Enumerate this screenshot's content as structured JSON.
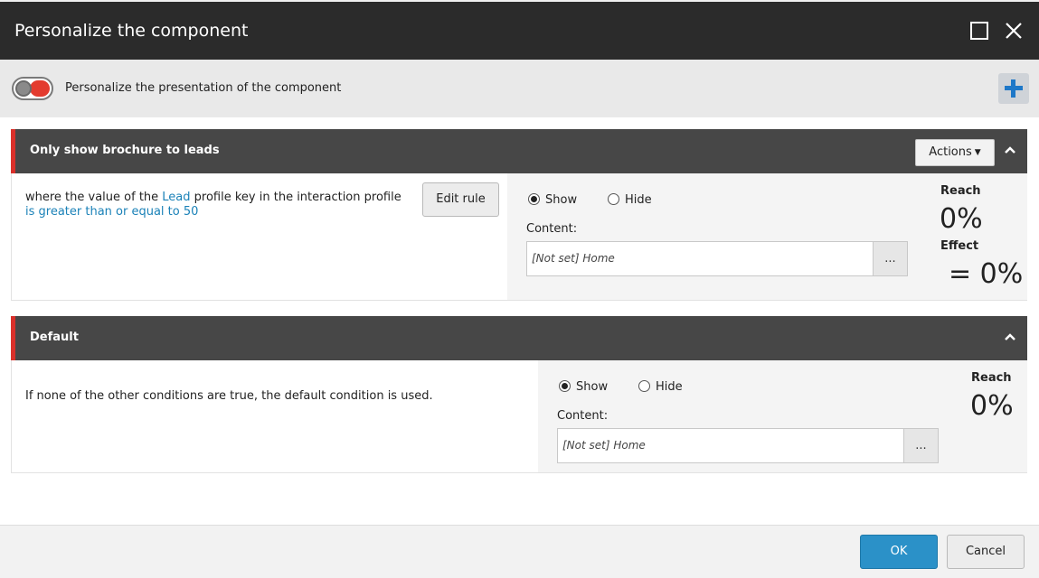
{
  "dialog": {
    "title": "Personalize the component"
  },
  "toggle": {
    "label": "Personalize the presentation of the component",
    "on": false
  },
  "sections": [
    {
      "title": "Only show brochure to leads",
      "actions_label": "Actions",
      "rule_prefix": "where the value of the ",
      "rule_link1": "Lead",
      "rule_middle": " profile key in the interaction profile ",
      "rule_link2": "is greater than or equal to 50",
      "edit_rule_label": "Edit rule",
      "show_label": "Show",
      "hide_label": "Hide",
      "selected": "Show",
      "content_label": "Content:",
      "content_value": "[Not set] Home",
      "browse_label": "...",
      "reach_label": "Reach",
      "reach_value": "0%",
      "effect_label": "Effect",
      "effect_value": "= 0%"
    },
    {
      "title": "Default",
      "rule_text": "If none of the other conditions are true, the default condition is used.",
      "show_label": "Show",
      "hide_label": "Hide",
      "selected": "Show",
      "content_label": "Content:",
      "content_value": "[Not set] Home",
      "browse_label": "...",
      "reach_label": "Reach",
      "reach_value": "0%"
    }
  ],
  "footer": {
    "ok_label": "OK",
    "cancel_label": "Cancel"
  },
  "colors": {
    "titlebar": "#2b2b2b",
    "section_header": "#474747",
    "accent_red": "#d9302a",
    "link_blue": "#1b82b8",
    "ok_blue": "#2b91c8",
    "plus_blue": "#1e78c8"
  },
  "icons": {
    "maximize": "maximize-icon",
    "close": "close-icon",
    "add": "plus-icon",
    "collapse": "chevron-up-icon",
    "dropdown": "caret-down-icon"
  }
}
